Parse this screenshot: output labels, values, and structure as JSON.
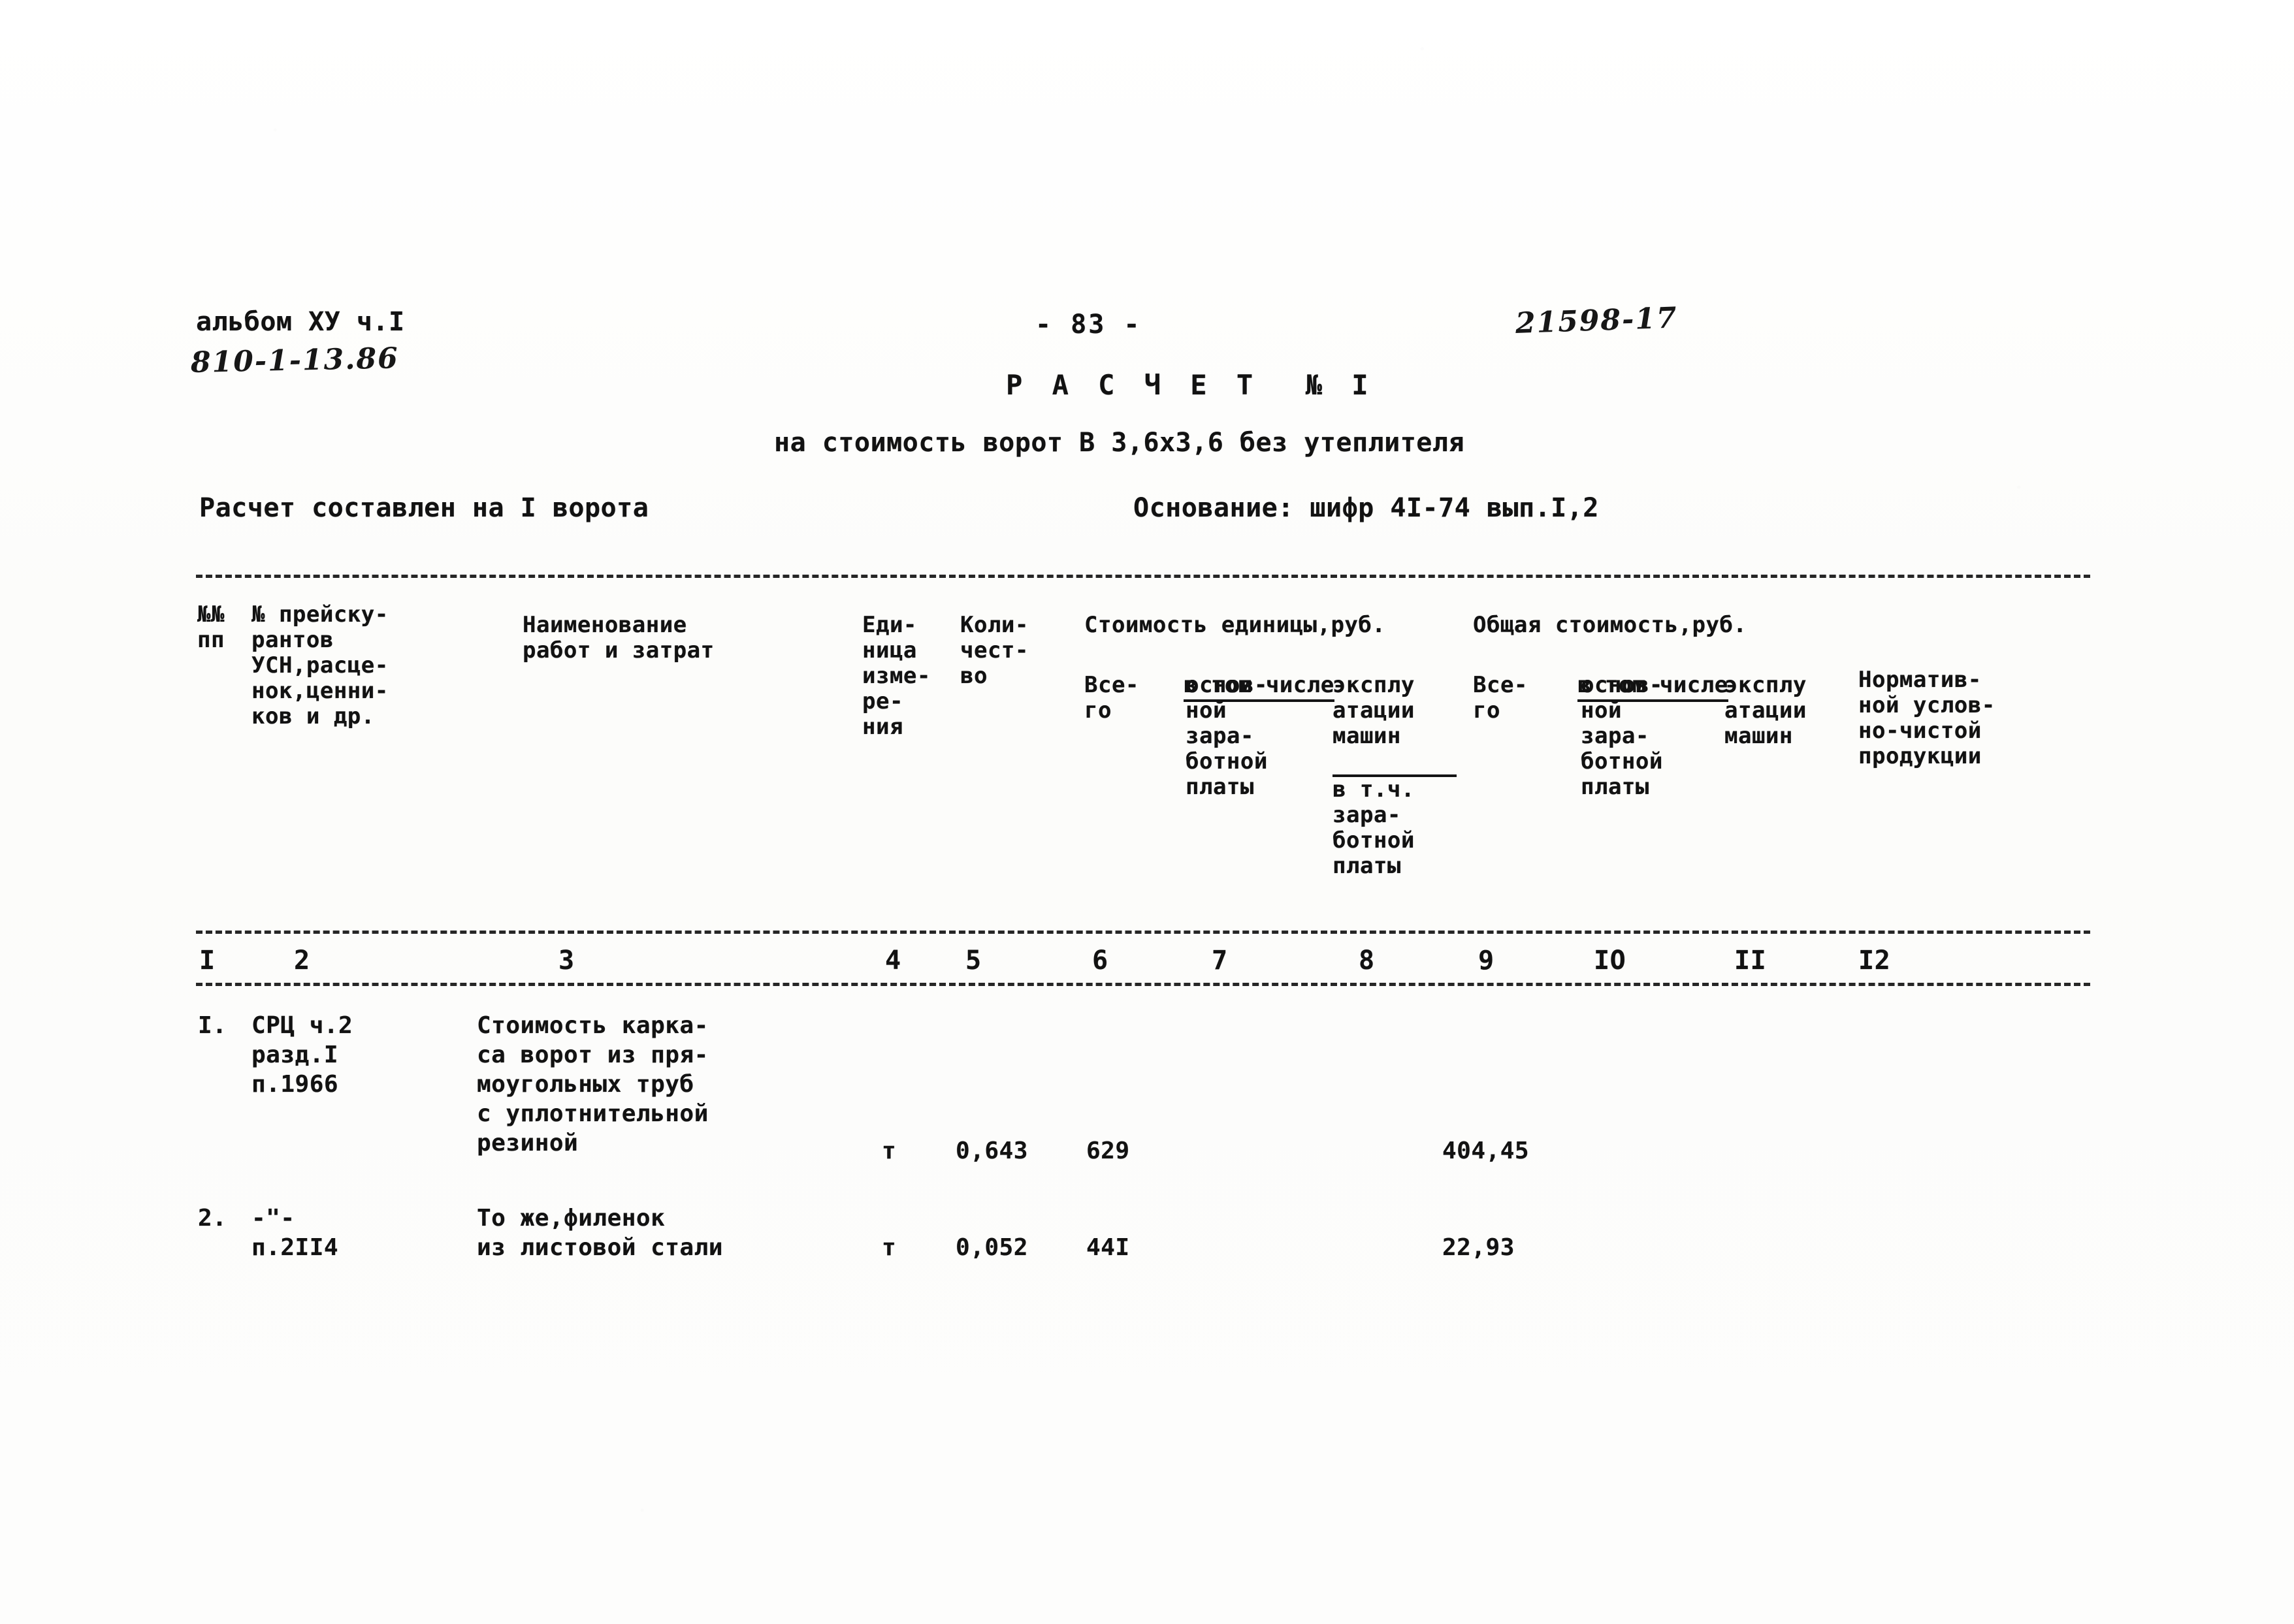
{
  "header": {
    "album_line": "альбом ХУ ч.I",
    "album_code": "810-1-13.86",
    "page_number": "- 83 -",
    "doc_code": "21598-17",
    "calc_title": "Р А С Ч Е Т  № I",
    "calc_subtitle": "на стоимость ворот В 3,6х3,6 без утеплителя",
    "made_for": "Расчет составлен на I ворота",
    "basis": "Основание: шифр 4I-74 вып.I,2"
  },
  "table": {
    "headers": {
      "col1": "№№\nпп",
      "col2": "№ прейску-\nрантов\nУСН,расце-\nнок,ценни-\nков и др.",
      "col3": "Наименование\nработ и затрат",
      "col4": "Еди-\nница\nизме-\nре-\nния",
      "col5": "Коли-\nчест-\nво",
      "group_unit_cost": "Стоимость единицы,руб.",
      "col6": "Все-\nго",
      "in_which_1": "в том числе",
      "col7": "основ-\nной\nзара-\nботной\nплаты",
      "col8": "эксплу\nатации\nмашин",
      "col8_sub": "в т.ч.\nзара-\nботной\nплаты",
      "group_total_cost": "Общая стоимость,руб.",
      "col9": "Все-\nго",
      "in_which_2": "в том числе",
      "col10": "основ-\nной\nзара-\nботной\nплаты",
      "col11": "эксплу\nатации\nмашин",
      "col12": "Норматив-\nной услов-\nно-чистой\nпродукции"
    },
    "column_numbers": [
      "I",
      "2",
      "3",
      "4",
      "5",
      "6",
      "7",
      "8",
      "9",
      "IO",
      "II",
      "I2"
    ],
    "column_number_x": [
      305,
      450,
      855,
      1355,
      1478,
      1672,
      1855,
      2080,
      2263,
      2440,
      2655,
      2845
    ],
    "rows": [
      {
        "num": "I.",
        "ref": "СРЦ ч.2\nразд.I\nп.1966",
        "description": "Стоимость карка-\nса ворот из пря-\nмоугольных труб\nс уплотнительной\nрезиной",
        "unit": "т",
        "quantity": "0,643",
        "unit_price_total": "629",
        "cost_total": "404,45"
      },
      {
        "num": "2.",
        "ref": "-\"-",
        "ref_line2": "п.2II4",
        "description": "То же,филенок\nиз листовой стали",
        "unit": "т",
        "quantity": "0,052",
        "unit_price_total": "44I",
        "cost_total": "22,93"
      }
    ]
  }
}
